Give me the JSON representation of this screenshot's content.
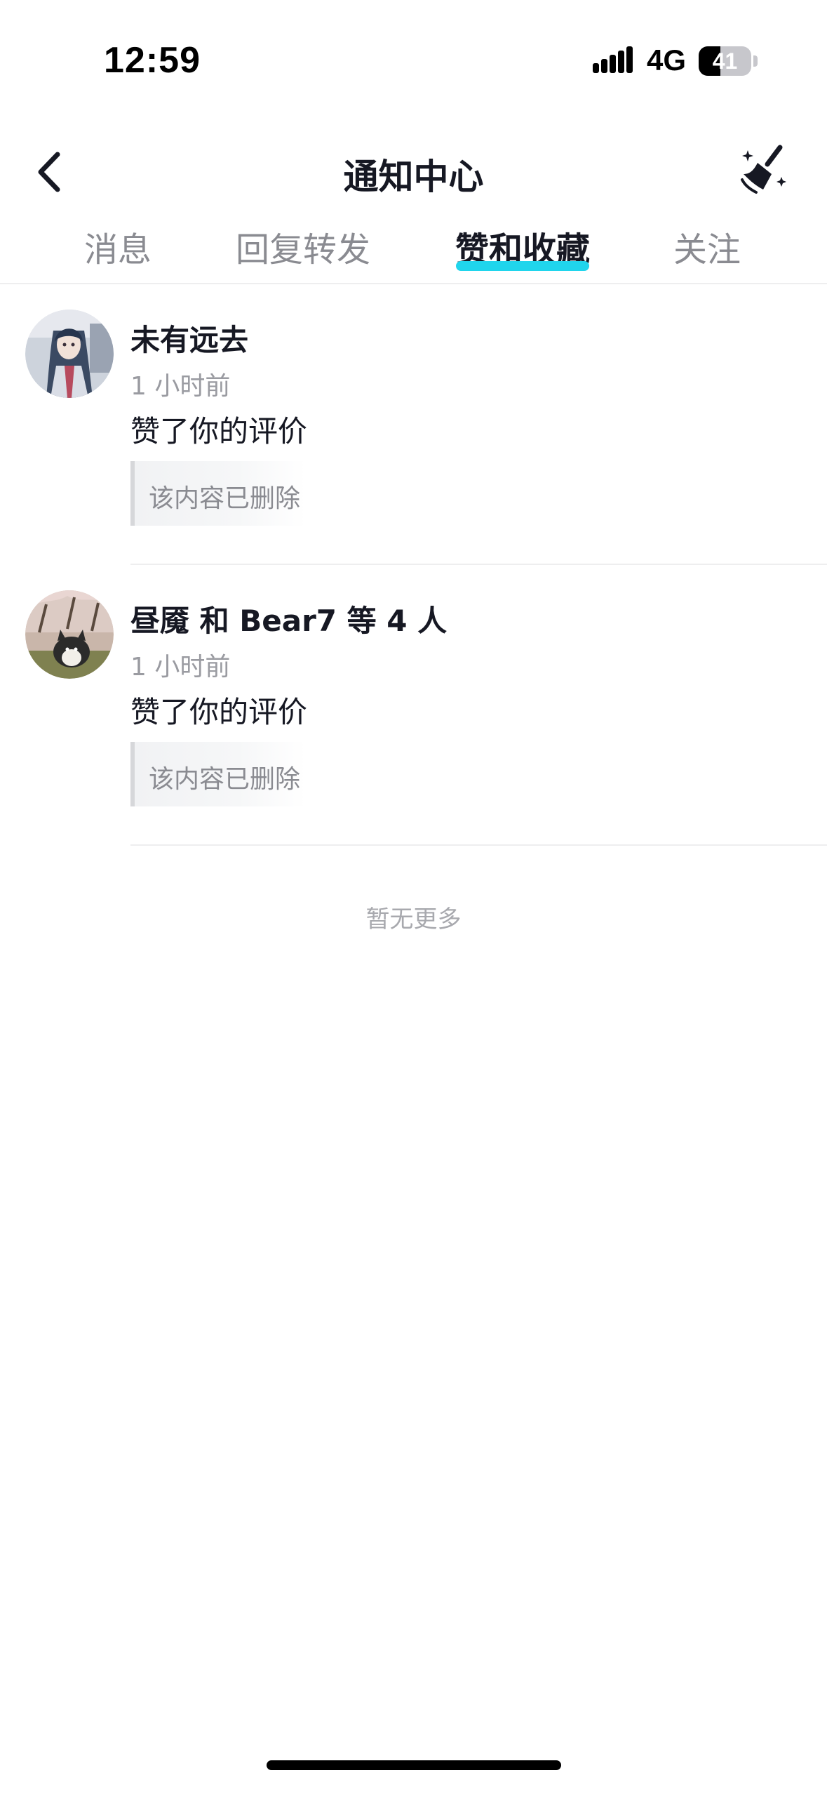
{
  "status_bar": {
    "time": "12:59",
    "network": "4G",
    "battery_level": "41",
    "battery_fraction": 0.41,
    "signal_icon": "cellular-signal-icon",
    "battery_icon": "battery-icon"
  },
  "header": {
    "title": "通知中心",
    "back_icon": "chevron-left-icon",
    "clean_icon": "broom-sparkle-icon"
  },
  "tabs": [
    {
      "label": "消息",
      "active": false
    },
    {
      "label": "回复转发",
      "active": false
    },
    {
      "label": "赞和收藏",
      "active": true
    },
    {
      "label": "关注",
      "active": false
    }
  ],
  "accent_color": "#20d5ec",
  "notifications": [
    {
      "name": "未有远去",
      "time": "1 小时前",
      "action": "赞了你的评价",
      "quote": "该内容已删除",
      "avatar": "avatar-anime-character"
    },
    {
      "name": "昼魇 和 Bear7 等 4 人",
      "time": "1 小时前",
      "action": "赞了你的评价",
      "quote": "该内容已删除",
      "avatar": "avatar-husky-dog"
    }
  ],
  "footer_text": "暂无更多"
}
